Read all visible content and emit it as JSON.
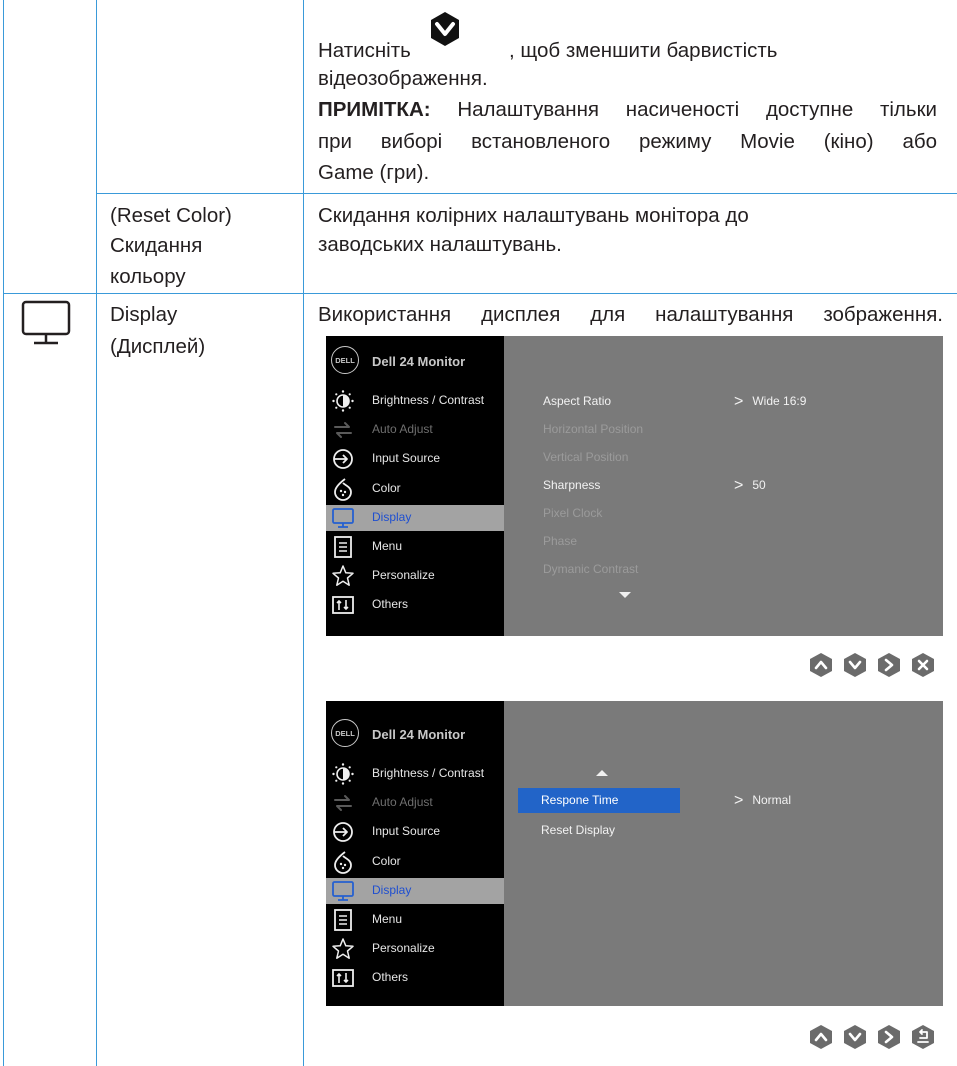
{
  "top_row": {
    "line1_a": "Натисніть",
    "line1_b": ", щоб зменшити барвистість",
    "line2": "відеозображення.",
    "note_label": "ПРИМІТКА:",
    "note_line1": "Налаштування насиченості доступне тільки",
    "note_line2": "при виборі встановленого режиму Movie (кіно) або",
    "note_line3": "Game (гри)."
  },
  "reset_row": {
    "name_line1": "(Reset Color)",
    "name_line2": "Скидання",
    "name_line3": "кольору",
    "desc_line1": "Скидання колірних налаштувань монітора до",
    "desc_line2": "заводських налаштувань."
  },
  "display_row": {
    "name_line1": "Display",
    "name_line2": "(Дисплей)",
    "desc": "Використання дисплея для налаштування зображення."
  },
  "osd": {
    "logo": "DELL",
    "title": "Dell 24 Monitor",
    "menu": [
      {
        "label": "Brightness / Contrast",
        "icon": "brightness-icon",
        "state": "normal"
      },
      {
        "label": "Auto Adjust",
        "icon": "auto-adjust-icon",
        "state": "dim"
      },
      {
        "label": "Input Source",
        "icon": "input-source-icon",
        "state": "normal"
      },
      {
        "label": "Color",
        "icon": "color-icon",
        "state": "normal"
      },
      {
        "label": "Display",
        "icon": "display-icon",
        "state": "selected"
      },
      {
        "label": "Menu",
        "icon": "menu-icon",
        "state": "normal"
      },
      {
        "label": "Personalize",
        "icon": "star-icon",
        "state": "normal"
      },
      {
        "label": "Others",
        "icon": "others-icon",
        "state": "normal"
      }
    ],
    "screen1": {
      "options": [
        "Aspect Ratio",
        "Horizontal Position",
        "Vertical Position",
        "Sharpness",
        "Pixel Clock",
        "Phase",
        "Dymanic Contrast"
      ],
      "values": {
        "aspect_ratio": "Wide 16:9",
        "sharpness": "50"
      },
      "nav_buttons": [
        "up-icon",
        "down-icon",
        "right-icon",
        "close-icon"
      ]
    },
    "screen2": {
      "options": [
        "Respone Time",
        "Reset Display"
      ],
      "values": {
        "response_time": "Normal"
      },
      "nav_buttons": [
        "up-icon",
        "down-icon",
        "right-icon",
        "back-icon"
      ]
    }
  },
  "colors": {
    "grid": "#3a9ad9",
    "osd_panel": "#7a7a7a",
    "osd_left": "#000000",
    "highlight": "#2264c8",
    "button": "#6b6b6b"
  }
}
